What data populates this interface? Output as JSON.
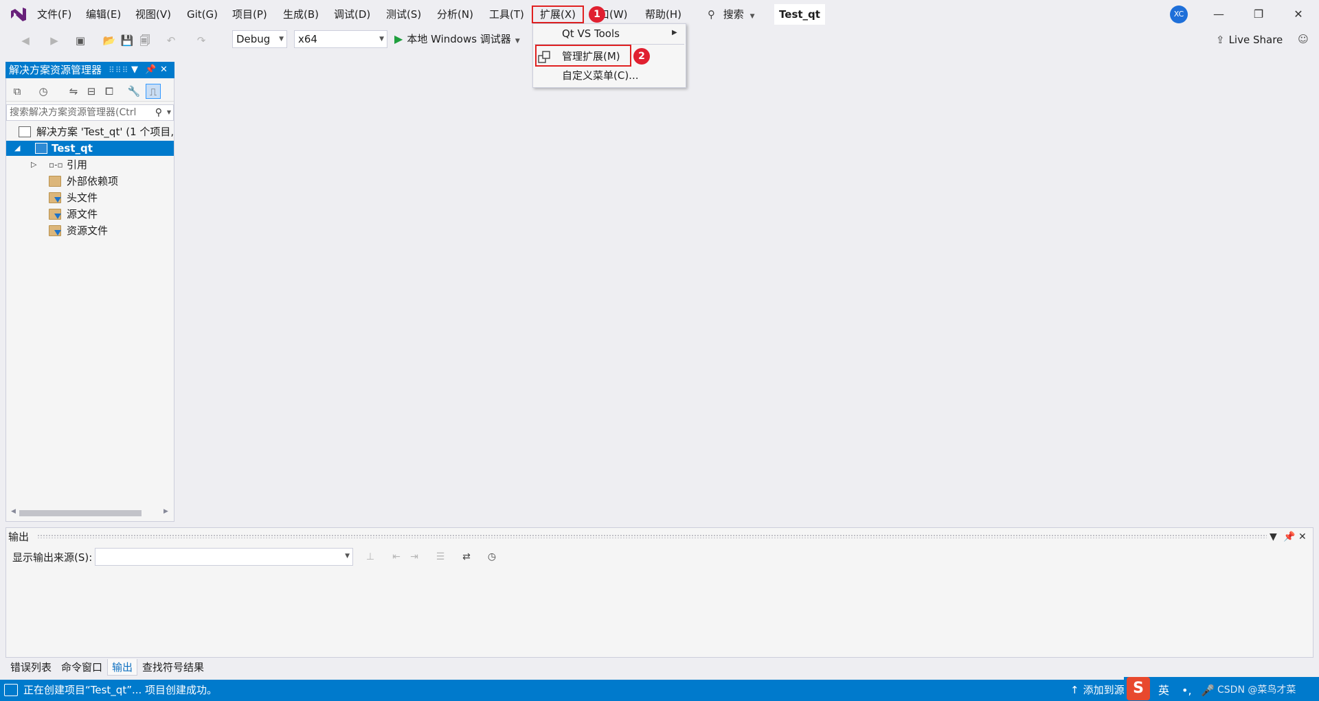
{
  "menubar": {
    "items": [
      "文件(F)",
      "编辑(E)",
      "视图(V)",
      "Git(G)",
      "项目(P)",
      "生成(B)",
      "调试(D)",
      "测试(S)",
      "分析(N)",
      "工具(T)",
      "扩展(X)",
      "口(W)",
      "帮助(H)"
    ],
    "search_label": "搜索",
    "project_title": "Test_qt",
    "avatar_initials": "XC"
  },
  "toolbar": {
    "config": "Debug",
    "platform": "x64",
    "run_label": "本地 Windows 调试器",
    "live_share": "Live Share"
  },
  "solution_explorer": {
    "title": "解决方案资源管理器",
    "search_placeholder": "搜索解决方案资源管理器(Ctrl",
    "tree": [
      {
        "label": "解决方案 'Test_qt' (1 个项目,"
      },
      {
        "label": "Test_qt"
      },
      {
        "label": "引用"
      },
      {
        "label": "外部依赖项"
      },
      {
        "label": "头文件"
      },
      {
        "label": "源文件"
      },
      {
        "label": "资源文件"
      }
    ]
  },
  "ext_menu": {
    "items": [
      "Qt VS Tools",
      "管理扩展(M)",
      "自定义菜单(C)..."
    ]
  },
  "markers": [
    "1",
    "2"
  ],
  "output": {
    "title": "输出",
    "source_label": "显示输出来源(S):",
    "source_value": ""
  },
  "bottom_tabs": [
    "错误列表",
    "命令窗口",
    "输出",
    "查找符号结果"
  ],
  "statusbar": {
    "message": "正在创建项目“Test_qt”... 项目创建成功。",
    "add_to_source": "添加到源",
    "ime_lang": "英",
    "ime_extra": "CSDN @菜鸟才菜"
  },
  "colors": {
    "accent": "#007acc",
    "highlight_box": "#e02020",
    "marker": "#e02030",
    "run_green": "#1f9f3e"
  }
}
